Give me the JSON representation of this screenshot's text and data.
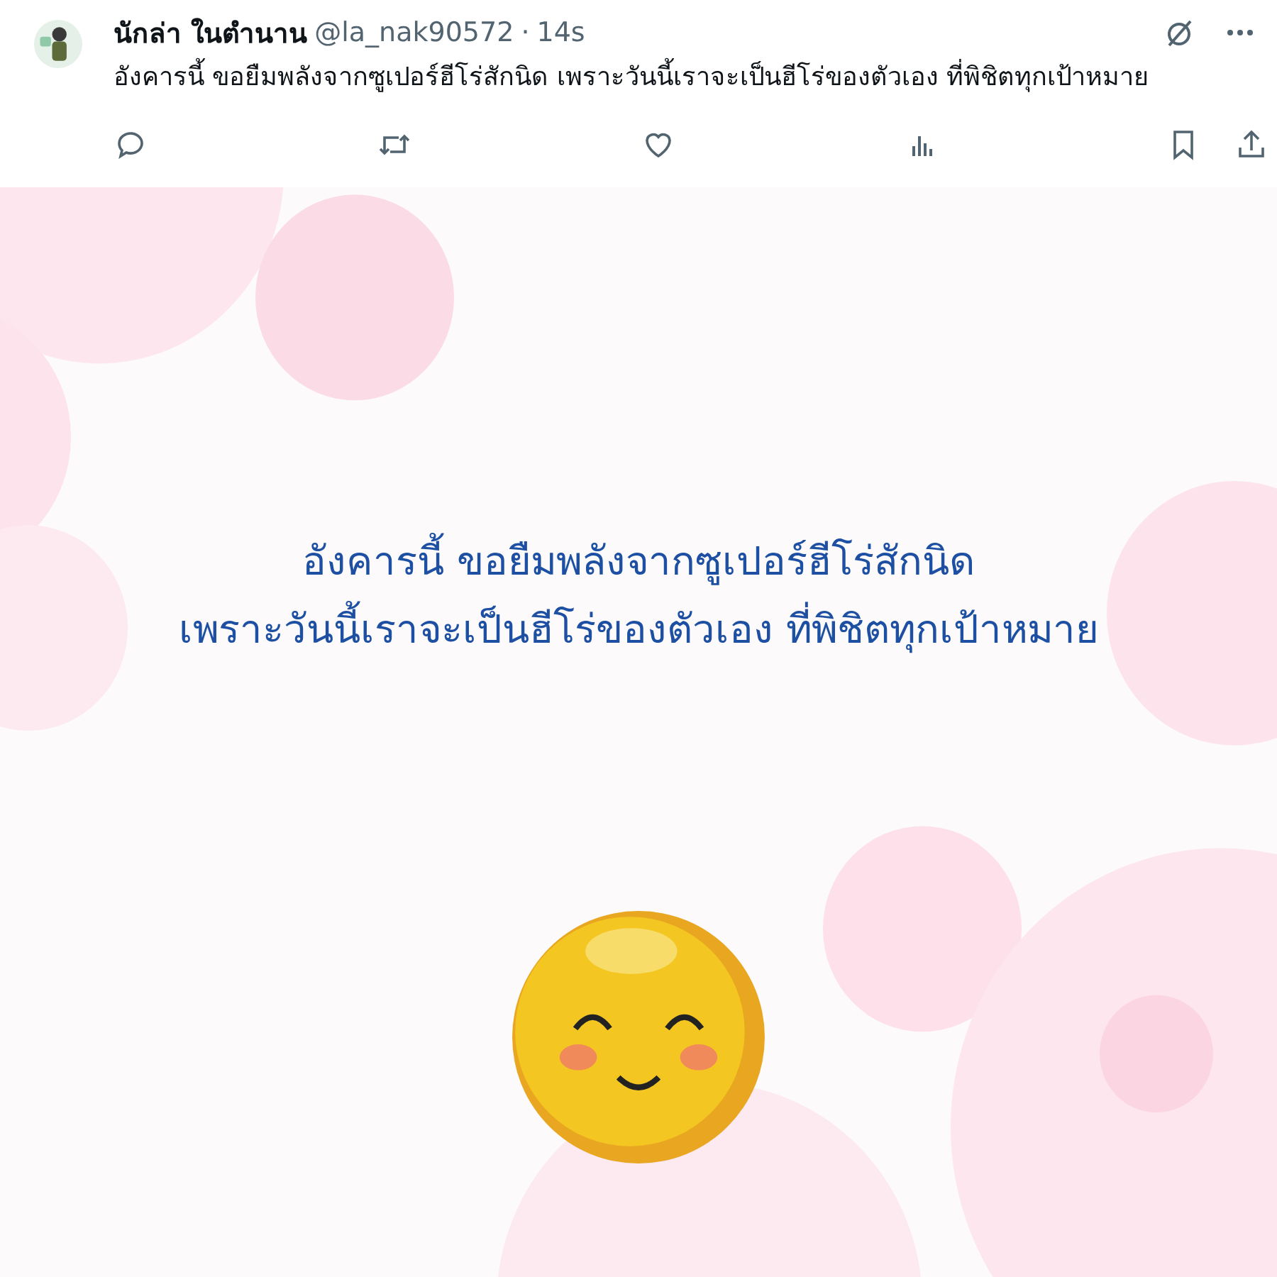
{
  "post": {
    "author": "นักล่า ในตำนาน",
    "handle": "@la_nak90572",
    "separator": "·",
    "time": "14s",
    "text": "อังคารนี้ ขอยืมพลังจากซูเปอร์ฮีโร่สักนิด เพราะวันนี้เราจะเป็นฮีโร่ของตัวเอง ที่พิชิตทุกเป้าหมาย"
  },
  "actions": [
    {
      "kind": "reply"
    },
    {
      "kind": "repost"
    },
    {
      "kind": "like"
    },
    {
      "kind": "views"
    },
    {
      "kind": "bookmark"
    },
    {
      "kind": "share"
    }
  ],
  "image": {
    "lines": [
      "อังคารนี้ ขอยืมพลังจากซูเปอร์ฮีโร่สักนิด",
      "เพราะวันนี้เราจะเป็นฮีโร่ของตัวเอง ที่พิชิตทุกเป้าหมาย"
    ]
  }
}
